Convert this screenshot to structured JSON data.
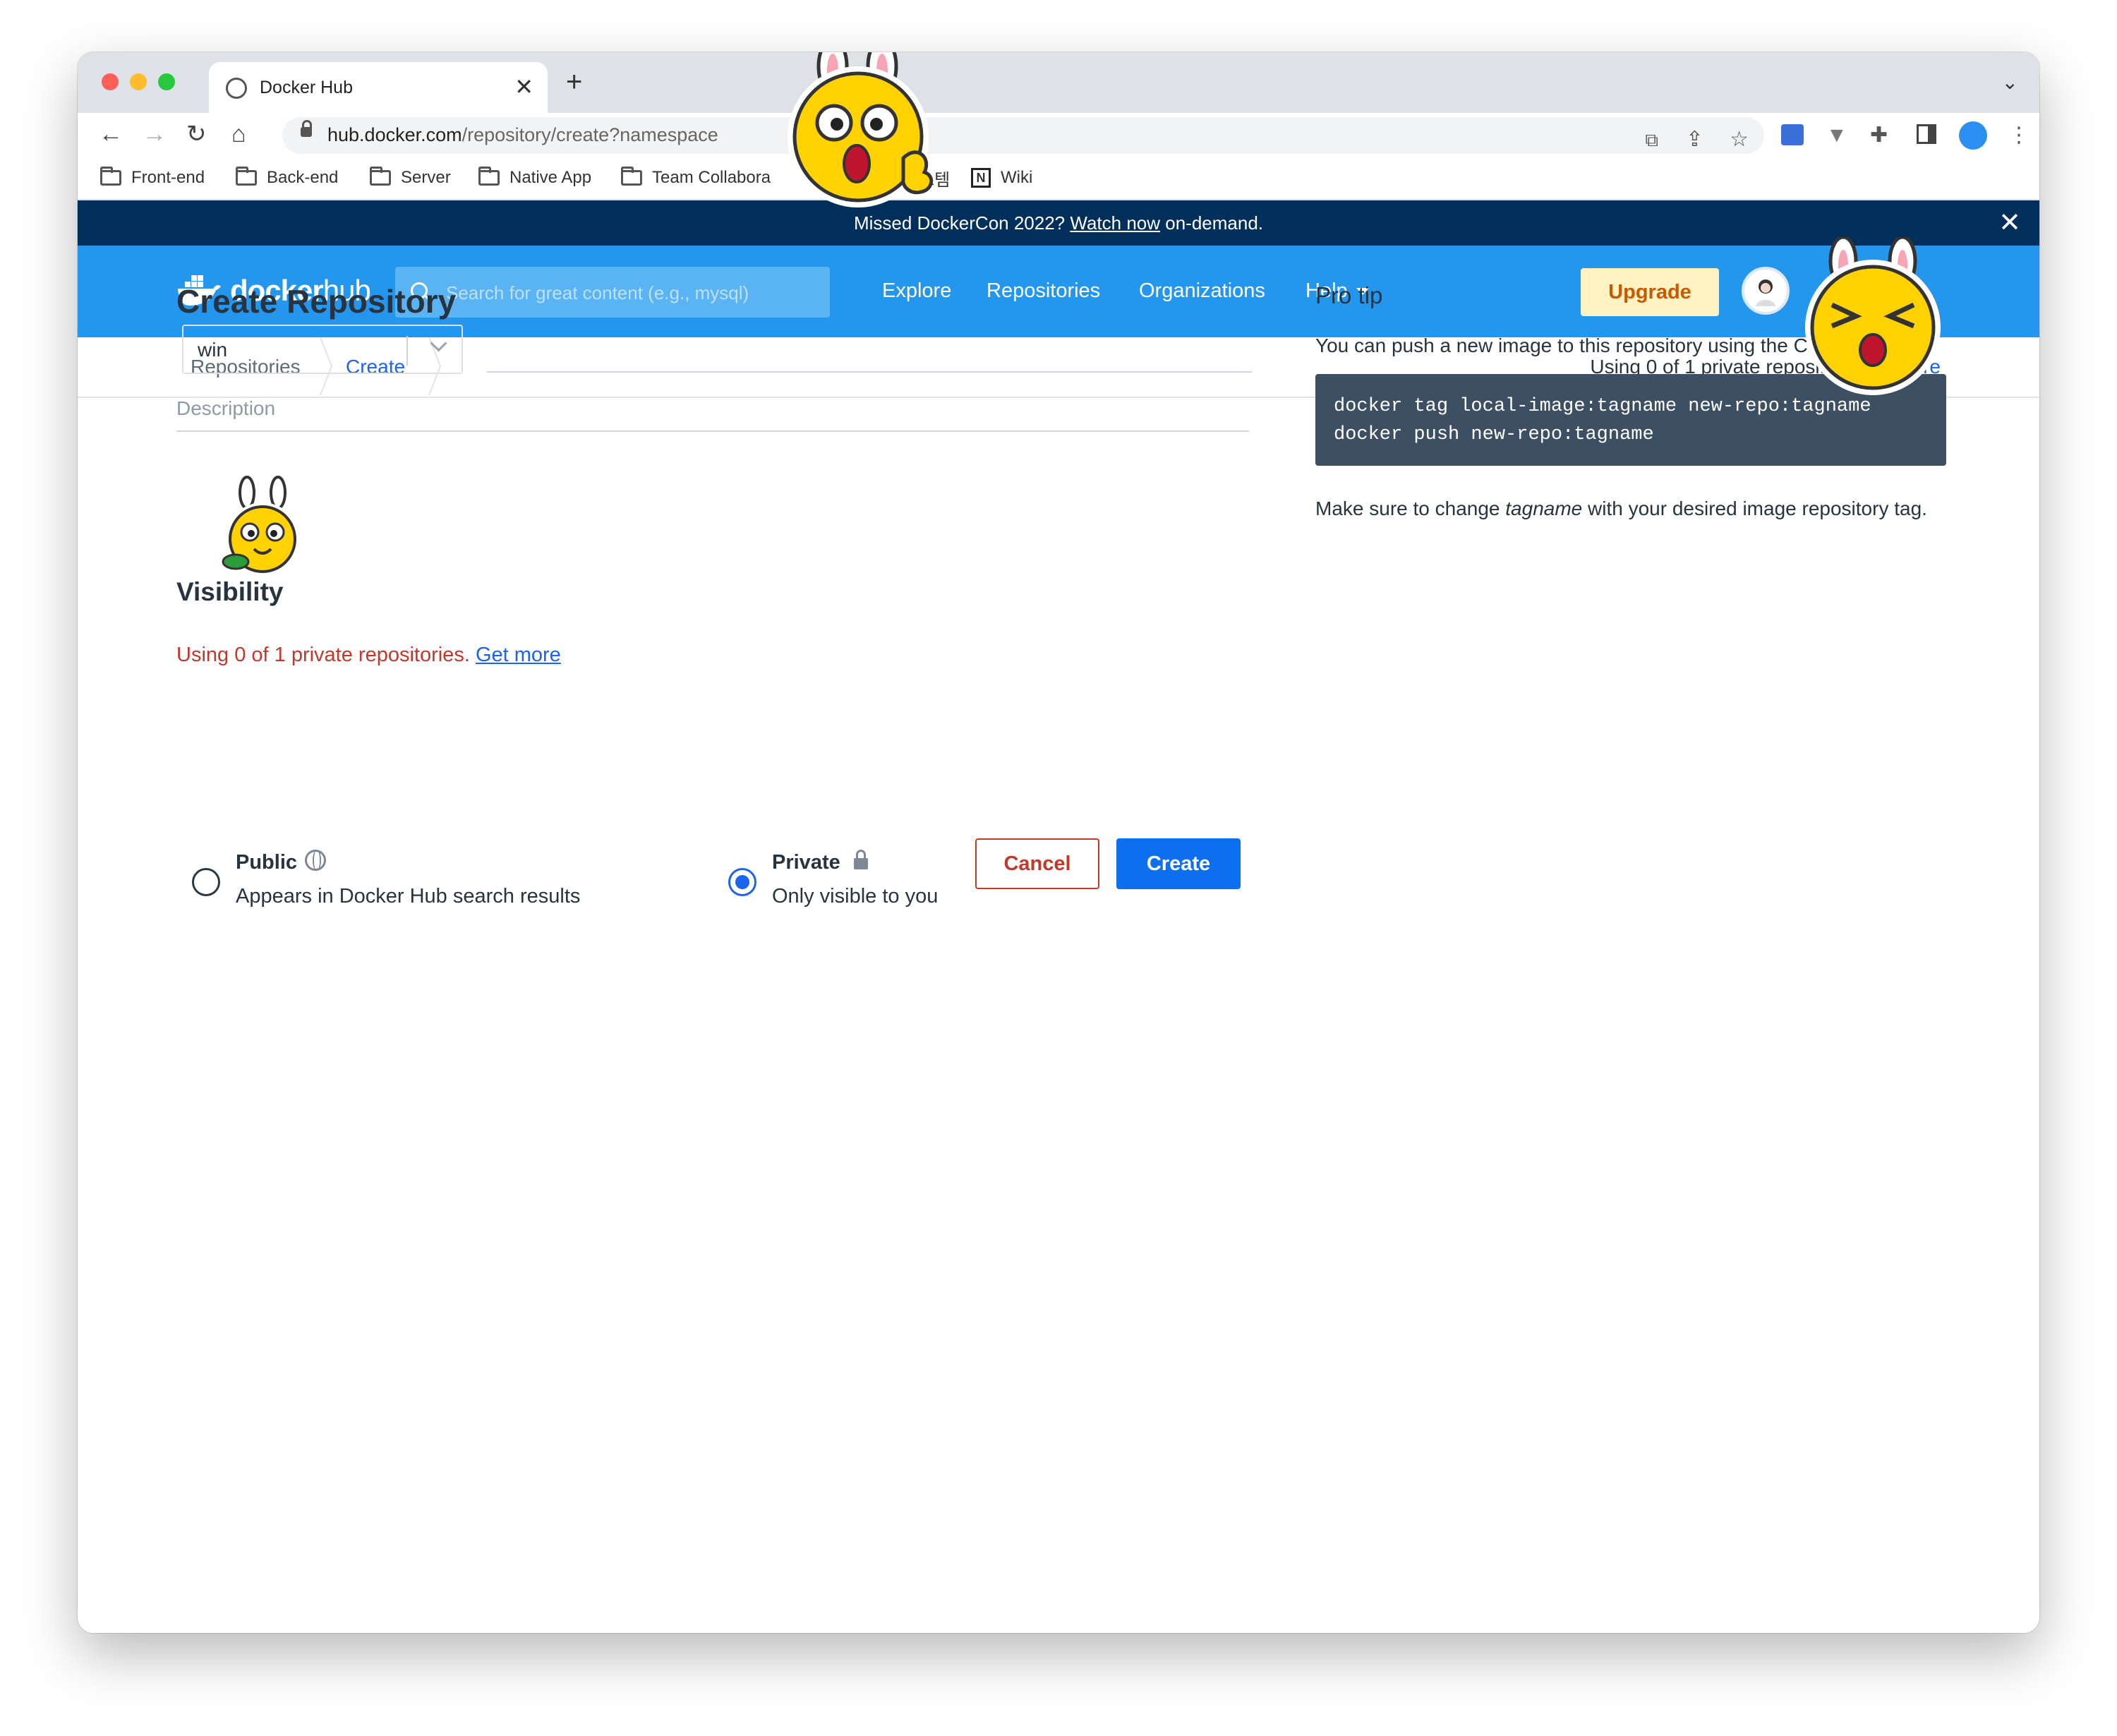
{
  "browser": {
    "tab_title": "Docker Hub",
    "url_host": "hub.docker.com",
    "url_path": "/repository/create?namespace",
    "bookmarks": [
      "Front-end",
      "Back-end",
      "Server",
      "Native App",
      "Team Collabora",
      "시스템",
      "Wiki"
    ]
  },
  "banner": {
    "prefix": "Missed DockerCon 2022?",
    "link": "Watch now",
    "suffix": "on-demand."
  },
  "nav": {
    "logo_main": "docker",
    "logo_sub": "hub",
    "search_placeholder": "Search for great content (e.g., mysql)",
    "links": [
      "Explore",
      "Repositories",
      "Organizations",
      "Help"
    ],
    "upgrade": "Upgrade"
  },
  "breadcrumb": {
    "items": [
      "Repositories",
      "Create"
    ],
    "usage": "Using 0 of 1 private repositori",
    "usage_link": "ore"
  },
  "form": {
    "title": "Create Repository",
    "namespace_value": "win",
    "description_placeholder": "Description",
    "visibility_title": "Visibility",
    "usage_text": "Using 0 of 1 private repositories.",
    "usage_link": "Get more",
    "options": [
      {
        "title": "Public",
        "subtitle": "Appears in Docker Hub search results",
        "selected": false
      },
      {
        "title": "Private",
        "subtitle": "Only visible to you",
        "selected": true
      }
    ],
    "cancel": "Cancel",
    "create": "Create"
  },
  "protip": {
    "title": "Pro tip",
    "text": "You can push a new image to this repository using the CLI",
    "code_line1": "docker tag local-image:tagname new-repo:tagname",
    "code_line2": "docker push new-repo:tagname",
    "note_prefix": "Make sure to change",
    "note_em": "tagname",
    "note_suffix": "with your desired image repository tag."
  },
  "colors": {
    "banner_bg": "#002f5c",
    "nav_bg": "#2496ed",
    "primary": "#0c6ff0",
    "danger": "#c0392b",
    "code_bg": "#3c4f63",
    "upgrade_bg": "#fff3c4"
  }
}
